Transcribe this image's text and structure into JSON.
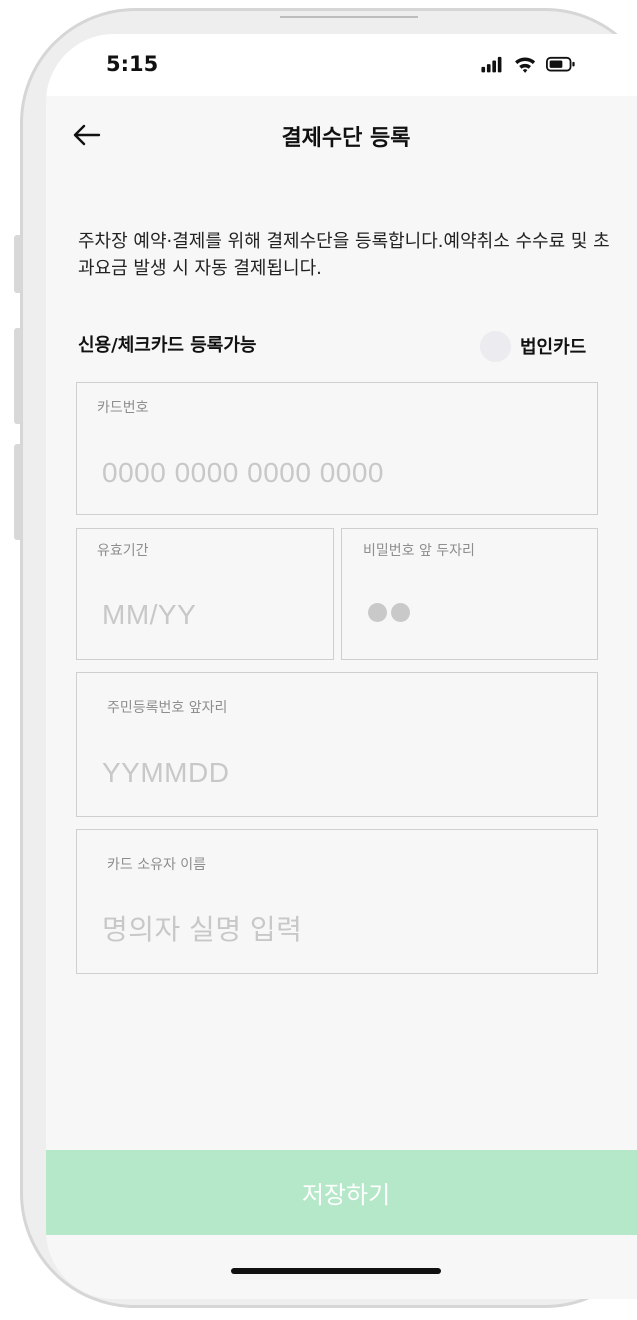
{
  "status_bar": {
    "time": "5:15"
  },
  "header": {
    "title": "결제수단 등록"
  },
  "description": "주차장 예약·결제를 위해 결제수단을 등록합니다.예약취소 수수료 및 초과요금 발생 시 자동 결제됩니다.",
  "card_type": {
    "label": "신용/체크카드 등록가능",
    "corporate_label": "법인카드",
    "corporate_selected": false
  },
  "fields": {
    "card_number": {
      "label": "카드번호",
      "placeholder": "0000 0000 0000 0000",
      "value": ""
    },
    "expiry": {
      "label": "유효기간",
      "placeholder": "MM/YY",
      "value": ""
    },
    "pin": {
      "label": "비밀번호 앞 두자리"
    },
    "birth": {
      "label": "주민등록번호 앞자리",
      "placeholder": "YYMMDD",
      "value": ""
    },
    "owner": {
      "label": "카드 소유자 이름",
      "placeholder": "명의자 실명 입력",
      "value": ""
    }
  },
  "save_button": {
    "label": "저장하기"
  },
  "colors": {
    "accent_disabled": "#b5e8c8",
    "screen_bg": "#f7f7f7",
    "field_border": "#cfcfcf"
  },
  "icons": [
    "back-arrow-icon",
    "signal-icon",
    "wifi-icon",
    "battery-icon"
  ]
}
